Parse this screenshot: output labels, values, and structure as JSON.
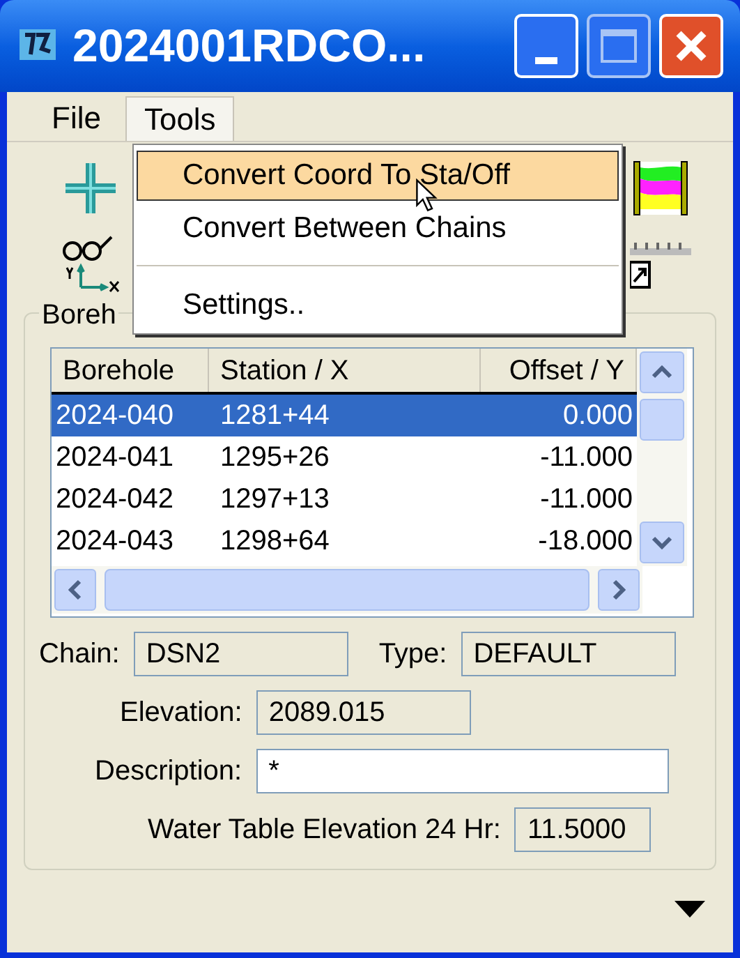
{
  "window": {
    "title": "2024001RDCO..."
  },
  "menu_bar": [
    {
      "label": "File",
      "selected": false
    },
    {
      "label": "Tools",
      "selected": true
    }
  ],
  "dropdown_menu": {
    "items": [
      {
        "kind": "item",
        "label": "Convert Coord To Sta/Off",
        "selected": true
      },
      {
        "kind": "item",
        "label": "Convert Between Chains",
        "selected": false
      },
      {
        "kind": "separator"
      },
      {
        "kind": "item",
        "label": "Settings..",
        "selected": false
      }
    ]
  },
  "group": {
    "label": "Boreh"
  },
  "table": {
    "columns": [
      "Borehole",
      "Station / X",
      "Offset / Y"
    ],
    "rows": [
      {
        "cells": [
          "2024-040",
          "1281+44",
          "0.000"
        ],
        "selected": true
      },
      {
        "cells": [
          "2024-041",
          "1295+26",
          "-11.000"
        ],
        "selected": false
      },
      {
        "cells": [
          "2024-042",
          "1297+13",
          "-11.000"
        ],
        "selected": false
      },
      {
        "cells": [
          "2024-043",
          "1298+64",
          "-18.000"
        ],
        "selected": false
      }
    ]
  },
  "fields": {
    "chain": {
      "label": "Chain:",
      "value": "DSN2",
      "editable": false
    },
    "type": {
      "label": "Type:",
      "value": "DEFAULT",
      "editable": false
    },
    "elevation": {
      "label": "Elevation:",
      "value": "2089.015",
      "editable": false
    },
    "description": {
      "label": "Description:",
      "value": "*",
      "editable": true
    },
    "water_table": {
      "label": "Water Table Elevation 24 Hr:",
      "value": "11.5000",
      "editable": false
    }
  }
}
